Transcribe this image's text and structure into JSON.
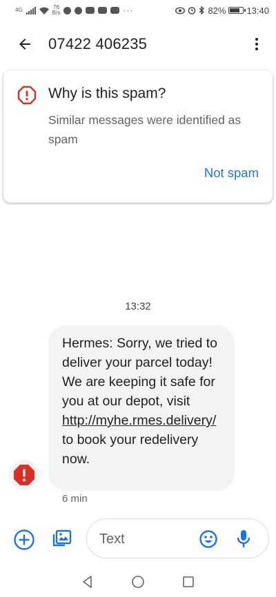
{
  "status_bar": {
    "net_type": "4G",
    "net_speed_value": "76",
    "net_speed_unit": "B/s",
    "battery_percent": "82%",
    "battery_level": 0.82,
    "time": "13:40"
  },
  "app_bar": {
    "title": "07422 406235"
  },
  "spam_card": {
    "title": "Why is this spam?",
    "description": "Similar messages were identified as spam",
    "not_spam_label": "Not spam"
  },
  "conversation": {
    "timestamp": "13:32",
    "message": {
      "text_before": "Hermes: Sorry, we tried to deliver your parcel today! We are keeping it safe for you at our depot, visit ",
      "link": "http://myhe.rmes.delivery/",
      "text_after": " to book your redelivery now.",
      "time": "6 min"
    }
  },
  "compose": {
    "placeholder": "Text"
  },
  "icons": {
    "back": "arrow-back-icon",
    "more": "more-vert-icon",
    "spam_warning": "error-outline-icon",
    "sender_avatar": "error-icon",
    "add": "add-circle-icon",
    "gallery": "gallery-icon",
    "emoji": "emoji-icon",
    "mic": "mic-icon"
  },
  "colors": {
    "accent": "#1a73e8",
    "warning": "#d93025",
    "bubble": "#f1f3f4"
  }
}
